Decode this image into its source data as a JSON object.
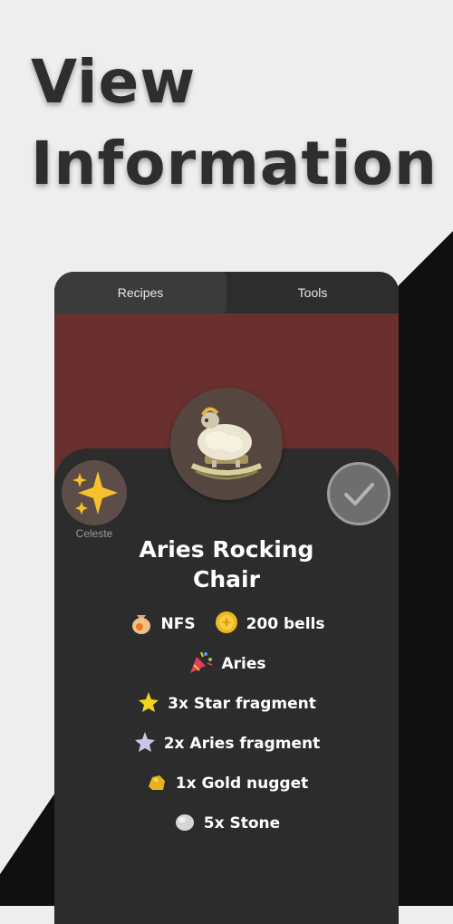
{
  "headline": {
    "line1": "View",
    "line2": "Information"
  },
  "tabs": [
    {
      "label": "Recipes"
    },
    {
      "label": "Tools"
    }
  ],
  "villager": {
    "name": "Celeste",
    "icon": "sparkles-icon"
  },
  "item": {
    "name_line1": "Aries Rocking",
    "name_line2": "Chair",
    "image": "aries-rocking-chair-icon",
    "buy": "NFS",
    "sell": "200 bells",
    "season": "Aries",
    "materials": [
      {
        "label": "3x Star fragment",
        "icon": "star-fragment-icon"
      },
      {
        "label": "2x Aries fragment",
        "icon": "aries-fragment-icon"
      },
      {
        "label": "1x Gold nugget",
        "icon": "gold-nugget-icon"
      },
      {
        "label": "5x Stone",
        "icon": "stone-icon"
      }
    ]
  },
  "colors": {
    "banner": "#6a2f2f",
    "card": "#2c2c2c",
    "accent_gold": "#f2b61b"
  }
}
